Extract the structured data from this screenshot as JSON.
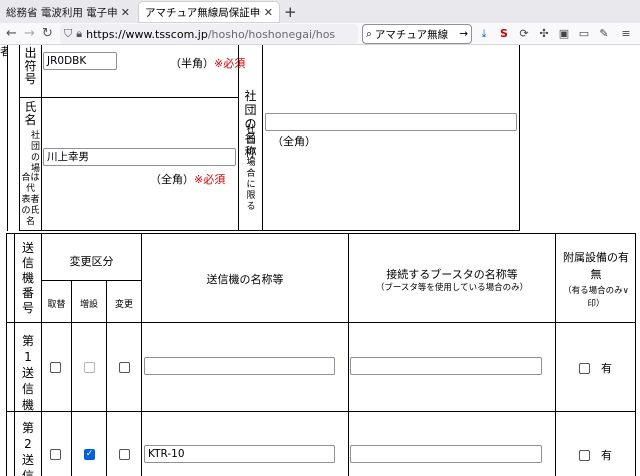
{
  "browser": {
    "tabs": [
      {
        "label": "総務省 電波利用 電子申請・",
        "active": false
      },
      {
        "label": "アマチュア無線局保証申込み",
        "active": true
      }
    ],
    "url_domain": "https://www.tsscom.jp",
    "url_path": "/hosho/hoshonegai/hos",
    "search_text": "アマチュア無線"
  },
  "form": {
    "left_edge_char": "者",
    "callsign": {
      "label": [
        "出",
        "符",
        "号"
      ],
      "value": "JR0DBK",
      "note": "（半角）",
      "required": "※必須"
    },
    "name": {
      "label_big": [
        "氏",
        "名"
      ],
      "label_small": [
        "社",
        "団",
        "の",
        "場",
        "合",
        "は",
        "代",
        "表",
        "者",
        "の",
        "氏",
        "名"
      ],
      "value": "川上幸男",
      "note": "（全角）",
      "required": "※必須"
    },
    "club": {
      "label_big": "社団の名称",
      "label_small": [
        "社",
        "団",
        "の",
        "場",
        "合",
        "に",
        "限",
        "る"
      ],
      "value": "",
      "note": "（全角）"
    }
  },
  "transmitters": {
    "headers": {
      "number": [
        "送",
        "信",
        "機",
        "番",
        "号"
      ],
      "change_category": "変更区分",
      "sub": [
        "取替",
        "増設",
        "変更"
      ],
      "name": "送信機の名称等",
      "booster": "接続するブースタの名称等",
      "booster_note": "（ブースタ等を使用している場合のみ）",
      "accessory": "附属設備の有無",
      "accessory_note": "（有る場合のみ∨印）"
    },
    "rows": [
      {
        "label": [
          "第",
          "1",
          "送",
          "信",
          "機"
        ],
        "replace": false,
        "add": false,
        "change": false,
        "name_value": "",
        "booster_value": "",
        "accessory": false,
        "accessory_label": "有"
      },
      {
        "label": [
          "第",
          "2",
          "送",
          "信"
        ],
        "replace": false,
        "add": true,
        "change": false,
        "name_value": "KTR-10",
        "booster_value": "",
        "accessory": false,
        "accessory_label": "有"
      }
    ]
  }
}
